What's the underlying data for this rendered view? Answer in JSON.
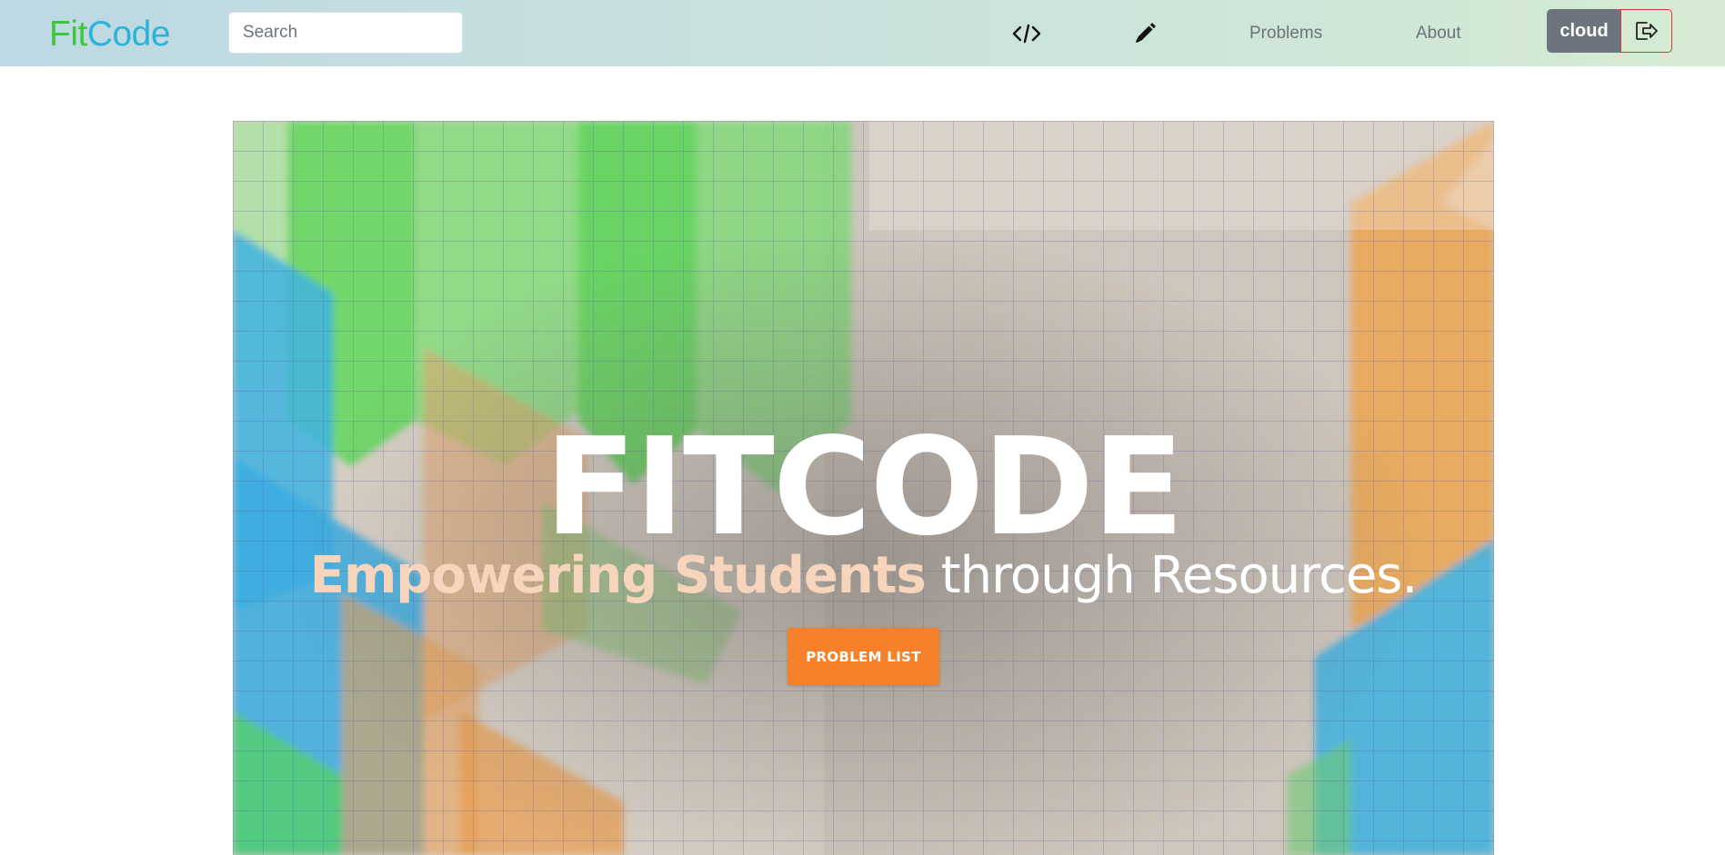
{
  "navbar": {
    "brand_part1": "Fit",
    "brand_part2": "Code",
    "search_placeholder": "Search",
    "code_icon": "code-icon",
    "edit_icon": "pencil-icon",
    "link_problems": "Problems",
    "link_about": "About",
    "user_label": "cloud",
    "logout_icon": "logout-icon"
  },
  "hero": {
    "title": "FITCODE",
    "subtitle_strong": "Empowering Students",
    "subtitle_light": " through Resources.",
    "button_label": "PROBLEM LIST"
  },
  "colors": {
    "brand_fit": "#3ec63e",
    "brand_code": "#2bb3d9",
    "button_orange": "#f7812b",
    "user_button": "#6c757d",
    "logout_border": "#dc3545"
  }
}
